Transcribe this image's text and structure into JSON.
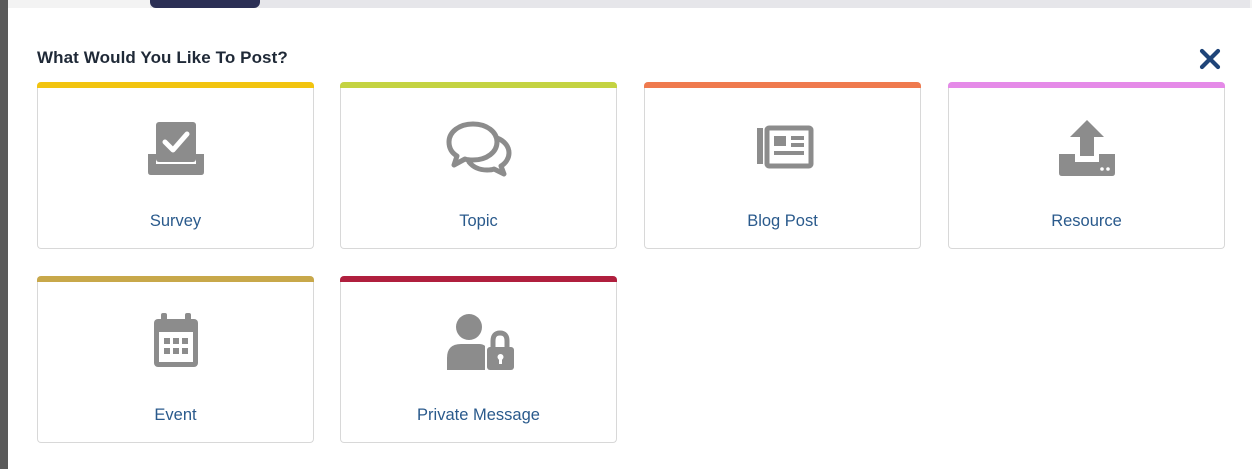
{
  "modal": {
    "title": "What Would You Like To Post?",
    "close_icon": "close-x-icon",
    "close_color": "#1f4478"
  },
  "cards": [
    {
      "label": "Survey",
      "icon": "survey-checkbox-icon",
      "accent": "#f2c40f"
    },
    {
      "label": "Topic",
      "icon": "chat-bubbles-icon",
      "accent": "#c4d342"
    },
    {
      "label": "Blog Post",
      "icon": "newspaper-icon",
      "accent": "#ef7a4e"
    },
    {
      "label": "Resource",
      "icon": "upload-icon",
      "accent": "#e58ae8"
    },
    {
      "label": "Event",
      "icon": "calendar-icon",
      "accent": "#c8a84a"
    },
    {
      "label": "Private Message",
      "icon": "user-lock-icon",
      "accent": "#b01f3e"
    }
  ],
  "colors": {
    "icon_gray": "#8c8c8c",
    "label_blue": "#2a5a8c"
  }
}
